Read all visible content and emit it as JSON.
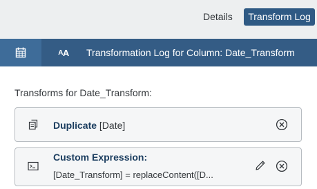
{
  "tabs": {
    "details": "Details",
    "transform_log": "Transform Log"
  },
  "header": {
    "title": "Transformation Log for Column: Date_Transform",
    "aa_big": "A",
    "aa_small": "A"
  },
  "section_label": "Transforms for Date_Transform:",
  "transforms": [
    {
      "name": "Duplicate",
      "detail": " [Date]",
      "icon": "duplicate-icon"
    },
    {
      "name": "Custom Expression:",
      "detail": "[Date_Transform] = replaceContent([D...",
      "icon": "expression-icon"
    }
  ],
  "colors": {
    "active_tab": "#2f5a84",
    "header_bar": "#345c85",
    "header_icon_bg": "#3e6c99",
    "card_bg": "#f5f6f7",
    "card_border": "#b7bcc1"
  }
}
